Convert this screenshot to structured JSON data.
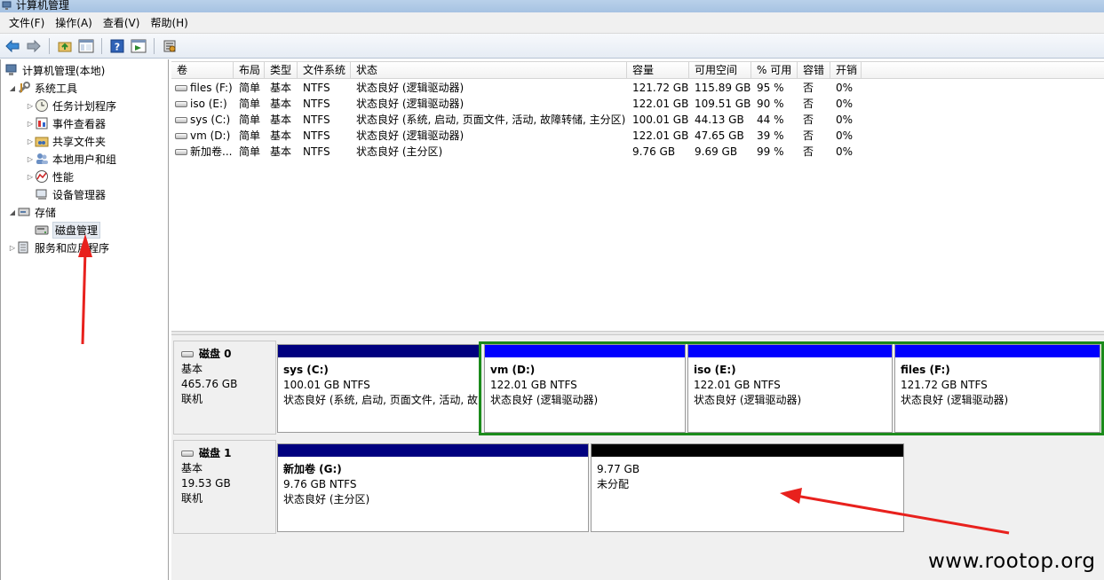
{
  "window": {
    "title": "计算机管理"
  },
  "menu": [
    "文件(F)",
    "操作(A)",
    "查看(V)",
    "帮助(H)"
  ],
  "toolbar": [
    "back-icon",
    "forward-icon",
    "up-folder-icon",
    "show-hide-tree-icon",
    "help-icon",
    "properties-icon",
    "disk-settings-icon"
  ],
  "tree": {
    "root": "计算机管理(本地)",
    "system_tools": "系统工具",
    "task_scheduler": "任务计划程序",
    "event_viewer": "事件查看器",
    "shared_folders": "共享文件夹",
    "local_users": "本地用户和组",
    "performance": "性能",
    "device_manager": "设备管理器",
    "storage": "存储",
    "disk_management": "磁盘管理",
    "services": "服务和应用程序"
  },
  "table": {
    "headers": [
      "卷",
      "布局",
      "类型",
      "文件系统",
      "状态",
      "容量",
      "可用空间",
      "% 可用",
      "容错",
      "开销"
    ],
    "rows": [
      [
        "files (F:)",
        "简单",
        "基本",
        "NTFS",
        "状态良好 (逻辑驱动器)",
        "121.72 GB",
        "115.89 GB",
        "95 %",
        "否",
        "0%"
      ],
      [
        "iso (E:)",
        "简单",
        "基本",
        "NTFS",
        "状态良好 (逻辑驱动器)",
        "122.01 GB",
        "109.51 GB",
        "90 %",
        "否",
        "0%"
      ],
      [
        "sys (C:)",
        "简单",
        "基本",
        "NTFS",
        "状态良好 (系统, 启动, 页面文件, 活动, 故障转储, 主分区)",
        "100.01 GB",
        "44.13 GB",
        "44 %",
        "否",
        "0%"
      ],
      [
        "vm (D:)",
        "简单",
        "基本",
        "NTFS",
        "状态良好 (逻辑驱动器)",
        "122.01 GB",
        "47.65 GB",
        "39 %",
        "否",
        "0%"
      ],
      [
        "新加卷...",
        "简单",
        "基本",
        "NTFS",
        "状态良好 (主分区)",
        "9.76 GB",
        "9.69 GB",
        "99 %",
        "否",
        "0%"
      ]
    ]
  },
  "disks": {
    "disk0": {
      "name": "磁盘 0",
      "type": "基本",
      "size": "465.76 GB",
      "status": "联机",
      "partitions": [
        {
          "name": "sys  (C:)",
          "size": "100.01 GB NTFS",
          "status": "状态良好 (系统, 启动, 页面文件, 活动, 故"
        },
        {
          "name": "vm  (D:)",
          "size": "122.01 GB NTFS",
          "status": "状态良好 (逻辑驱动器)"
        },
        {
          "name": "iso  (E:)",
          "size": "122.01 GB NTFS",
          "status": "状态良好 (逻辑驱动器)"
        },
        {
          "name": "files  (F:)",
          "size": "121.72 GB NTFS",
          "status": "状态良好 (逻辑驱动器)"
        }
      ]
    },
    "disk1": {
      "name": "磁盘 1",
      "type": "基本",
      "size": "19.53 GB",
      "status": "联机",
      "partitions": [
        {
          "name": "新加卷  (G:)",
          "size": "9.76 GB NTFS",
          "status": "状态良好 (主分区)"
        },
        {
          "name": "",
          "size": "9.77 GB",
          "status": "未分配"
        }
      ]
    }
  },
  "colors": {
    "primary_bar": "#00007f",
    "logical_bar": "#0000ff",
    "unallocated_bar": "#000000",
    "extended_frame": "#1b8b1b",
    "annotation_arrow": "#e8211d"
  },
  "watermark": "www.rootop.org"
}
